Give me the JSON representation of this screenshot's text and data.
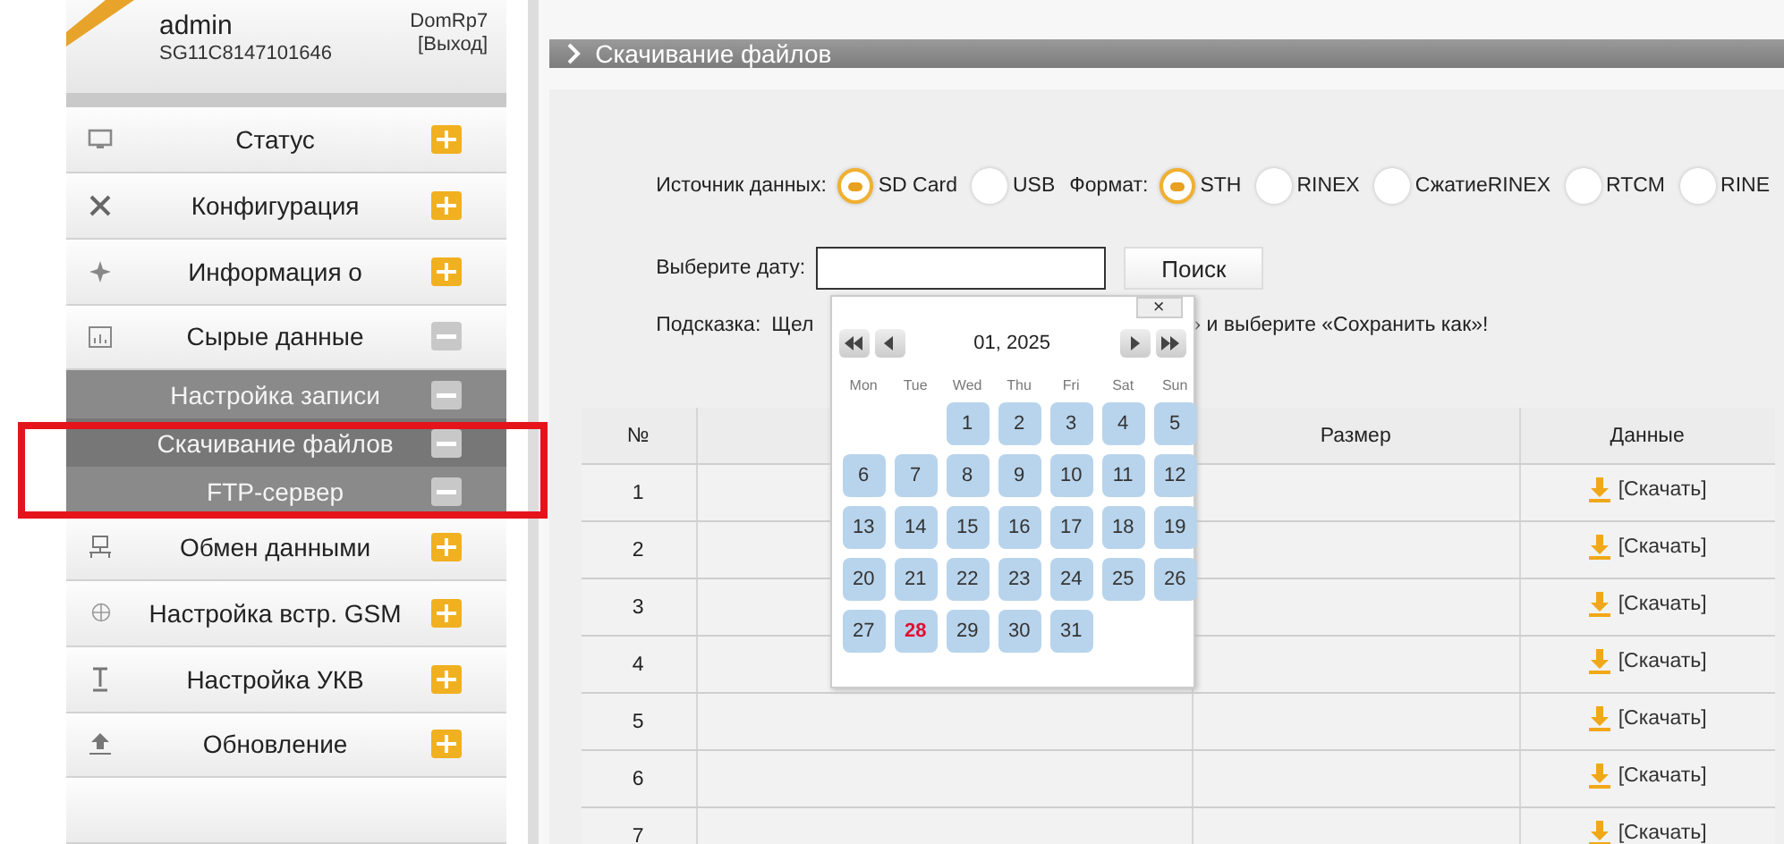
{
  "account": {
    "user": "admin",
    "serial": "SG11C8147101646",
    "device": "DomRp7",
    "logout": "[Выход]"
  },
  "sidebar": {
    "items": [
      {
        "label": "Статус",
        "expanded": false
      },
      {
        "label": "Конфигурация",
        "expanded": false
      },
      {
        "label": "Информация о",
        "expanded": false
      },
      {
        "label": "Сырые данные",
        "expanded": true,
        "children": [
          {
            "label": "Настройка записи",
            "selected": false
          },
          {
            "label": "Скачивание файлов",
            "selected": true
          },
          {
            "label": "FTP-сервер",
            "selected": false
          }
        ]
      },
      {
        "label": "Обмен данными",
        "expanded": false
      },
      {
        "label": "Настройка встр. GSM",
        "expanded": false
      },
      {
        "label": "Настройка УКВ",
        "expanded": false
      },
      {
        "label": "Обновление",
        "expanded": false
      }
    ]
  },
  "page_title": "Скачивание файлов",
  "source": {
    "label": "Источник данных:",
    "options": [
      {
        "label": "SD Card",
        "selected": true
      },
      {
        "label": "USB",
        "selected": false
      }
    ]
  },
  "format": {
    "label": "Формат:",
    "options": [
      {
        "label": "STH",
        "selected": true
      },
      {
        "label": "RINEX",
        "selected": false
      },
      {
        "label": "СжатиеRINEX",
        "selected": false
      },
      {
        "label": "RTCM",
        "selected": false
      },
      {
        "label": "RINE",
        "selected": false
      }
    ]
  },
  "date": {
    "label": "Выберите дату:",
    "search_button": "Поиск"
  },
  "hint": {
    "label": "Подсказка:",
    "text_start": "Щел",
    "text_end": "» и выберите «Сохранить как»!"
  },
  "calendar": {
    "close": "×",
    "month": "01, 2025",
    "weekdays": [
      "Mon",
      "Tue",
      "Wed",
      "Thu",
      "Fri",
      "Sat",
      "Sun"
    ],
    "days": [
      {
        "day": "1",
        "today": false
      },
      {
        "day": "2",
        "today": false
      },
      {
        "day": "3",
        "today": false
      },
      {
        "day": "4",
        "today": false
      },
      {
        "day": "5",
        "today": false
      },
      {
        "day": "6",
        "today": false
      },
      {
        "day": "7",
        "today": false
      },
      {
        "day": "8",
        "today": false
      },
      {
        "day": "9",
        "today": false
      },
      {
        "day": "10",
        "today": false
      },
      {
        "day": "11",
        "today": false
      },
      {
        "day": "12",
        "today": false
      },
      {
        "day": "13",
        "today": false
      },
      {
        "day": "14",
        "today": false
      },
      {
        "day": "15",
        "today": false
      },
      {
        "day": "16",
        "today": false
      },
      {
        "day": "17",
        "today": false
      },
      {
        "day": "18",
        "today": false
      },
      {
        "day": "19",
        "today": false
      },
      {
        "day": "20",
        "today": false
      },
      {
        "day": "21",
        "today": false
      },
      {
        "day": "22",
        "today": false
      },
      {
        "day": "23",
        "today": false
      },
      {
        "day": "24",
        "today": false
      },
      {
        "day": "25",
        "today": false
      },
      {
        "day": "26",
        "today": false
      },
      {
        "day": "27",
        "today": false
      },
      {
        "day": "28",
        "today": true
      },
      {
        "day": "29",
        "today": false
      },
      {
        "day": "30",
        "today": false
      },
      {
        "day": "31",
        "today": false
      }
    ]
  },
  "table": {
    "columns": [
      "№",
      "",
      "Размер",
      "Данные"
    ],
    "rows": [
      {
        "number": "1",
        "link": "[Скачать]"
      },
      {
        "number": "2",
        "link": "[Скачать]"
      },
      {
        "number": "3",
        "link": "[Скачать]"
      },
      {
        "number": "4",
        "link": "[Скачать]"
      },
      {
        "number": "5",
        "link": "[Скачать]"
      },
      {
        "number": "6",
        "link": "[Скачать]"
      },
      {
        "number": "7",
        "link": "[Скачать]"
      }
    ]
  }
}
